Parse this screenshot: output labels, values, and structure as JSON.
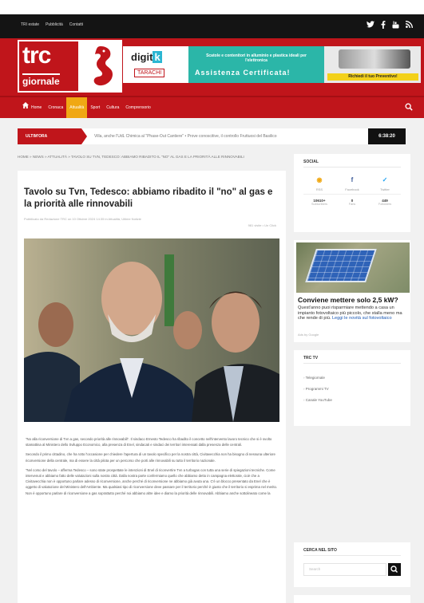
{
  "topbar": {
    "links": [
      "TRI estate",
      "Pubblicità",
      "Contatti"
    ]
  },
  "social_icons": [
    "twitter-icon",
    "facebook-icon",
    "youtube-icon",
    "rss-icon"
  ],
  "logo": {
    "line1": "trc",
    "line2": "giornale"
  },
  "ads": {
    "digitek": {
      "brand_prefix": "digit",
      "brand_suffix": "k",
      "sub": "TARACHI"
    },
    "banner": {
      "line1": "Scatole e contenitori in alluminio e plastica ideali per l'elettronica",
      "line2": "Assistenza Certificata!"
    },
    "cta": "Richiedi il tuo Preventivo!"
  },
  "nav": {
    "items": [
      "Home",
      "Cronaca",
      "Attualità",
      "Sport",
      "Cultura",
      "Comprensorio"
    ],
    "active_index": 2
  },
  "ticker": {
    "label": "ULTIM'ORA",
    "text": "Villa, anche l'UdL Chimica al \"Phase-Out Cantiere\"  •  Prove conoscitive, il controllo Fruttuosi del Basilico",
    "clock": "6:38:20"
  },
  "breadcrumb": "HOME » NEWS » ATTUALITÀ » TAVOLO SU TVN, TEDESCO: ABBIAMO RIBADITO IL \"NO\" AL GAS E LA PRIORITÀ ALLE RINNOVABILI",
  "article": {
    "title": "Tavolo su Tvn, Tedesco: abbiamo ribadito il \"no\" al gas e la priorità alle rinnovabili",
    "meta": "Pubblicato da Redazione TRC on 10 Ottobre 2024 14:35 in Attualità, Ultime Notizie",
    "meta2": "981 visite • Un Click",
    "paragraphs": [
      "\"No alla riconversione di Tvn a gas, secondo priorità alle rinnovabili\". Il sindaco Ernesto Tedesco ha ribadito il concetto nell'intervento lavoro tecnico che si è svolto stamattina al Ministero dello Sviluppo Economico, alla presenza di Enel, sindacati e sindaci dei territori interessati dalla presenza delle centrali.",
      "Secondo il primo cittadino, che ha rotto l'occasione per chiedere l'apertura di un tavolo specifico per la nostra città, Civitavecchia non ha bisogno di nessuna ulteriore riconversione della centrale, ma di essere la città pilota per un percorso che porti alle rinnovabili su tutto il territorio nazionale.",
      "\"Nel corso del tavolo – afferma Tedesco – sono state prospettate le intenzioni di Enel di riconvertire Tvn a turbogas con tutta una serie di spiegazioni tecniche. Come intervenuti e abbiamo fatto delle valutazioni sulla nostra città. Dalla nostra parte confermiamo quello che abbiamo detto in campagna elettorale, cioè che a Civitavecchia non è opportuno parlare adesso di riconversione, anche perché di riconversione ne abbiamo già avuta una. C'è un blocco presentato da Enel che è oggetto di valutazione del Ministero dell'Ambiente. Ma qualsiasi tipo di riconversione deve passare per il territorio perché è giusto che il territorio si esprima nel merito. Non è opportuno parlare di riconversione a gas soprattutto perché noi abbiamo altre idee e diamo la priorità delle rinnovabili. Abbiamo anche sottolineato come la"
    ]
  },
  "sidebar": {
    "social": {
      "title": "SOCIAL",
      "items": [
        {
          "icon": "rss-icon",
          "label": "RSS",
          "count": "10610+",
          "sub": "Subscribers"
        },
        {
          "icon": "facebook-icon",
          "label": "Facebook",
          "count": "0",
          "sub": "Fans"
        },
        {
          "icon": "twitter-icon",
          "label": "Twitter",
          "count": "449",
          "sub": "Followers"
        }
      ]
    },
    "ad": {
      "headline": "Conviene mettere solo 2,5 kW?",
      "text": "Quest'anno puoi risparmiare mettendo a casa un impianto fotovoltaico più piccolo, che stalla meno ma che rende di più.",
      "link": "Leggi le novità sul fotovoltaico",
      "footer": "Ads by Google"
    },
    "tv": {
      "title": "TRC TV",
      "items": [
        "Telegiornale",
        "Programmi TV",
        "Canale YouTube"
      ]
    },
    "search": {
      "title": "CERCA NEL SITO",
      "placeholder": "Search"
    }
  },
  "colors": {
    "brand_red": "#c0151b",
    "accent_orange": "#f0a814",
    "teal": "#2bb6a8"
  }
}
